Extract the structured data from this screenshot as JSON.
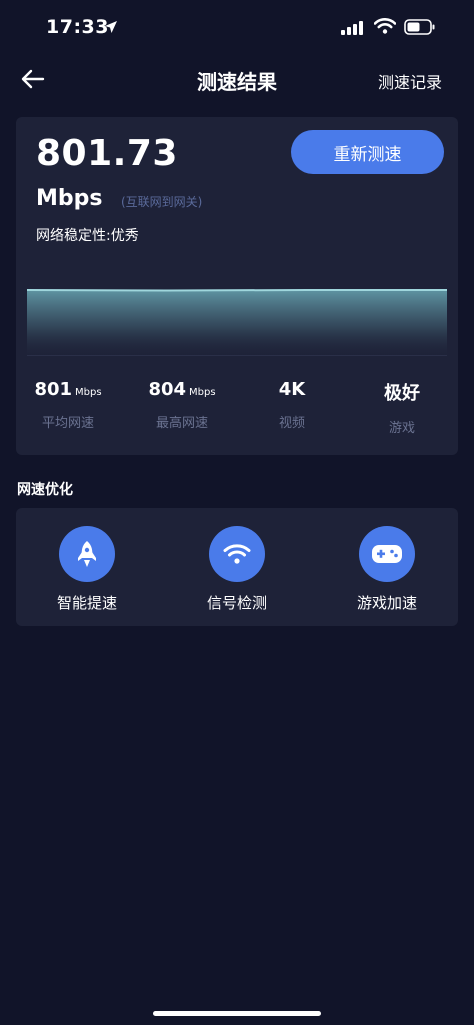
{
  "status_bar": {
    "time": "17:33"
  },
  "nav": {
    "title": "测速结果",
    "history_label": "测速记录"
  },
  "result": {
    "speed_value": "801.73",
    "speed_unit": "Mbps",
    "speed_note": "(互联网到网关)",
    "stability": "网络稳定性:优秀",
    "retest_label": "重新测速",
    "stats": [
      {
        "value": "801",
        "unit": "Mbps",
        "label": "平均网速"
      },
      {
        "value": "804",
        "unit": "Mbps",
        "label": "最高网速"
      },
      {
        "value": "4K",
        "unit": "",
        "label": "视频"
      },
      {
        "value": "极好",
        "unit": "",
        "label": "游戏"
      }
    ]
  },
  "optimize": {
    "title": "网速优化",
    "items": [
      {
        "label": "智能提速",
        "icon": "rocket-icon"
      },
      {
        "label": "信号检测",
        "icon": "wifi-icon"
      },
      {
        "label": "游戏加速",
        "icon": "gamepad-icon"
      }
    ]
  },
  "colors": {
    "background": "#111429",
    "card": "#1e2238",
    "accent": "#4a7bea",
    "graph_line": "#9fd6dc"
  }
}
